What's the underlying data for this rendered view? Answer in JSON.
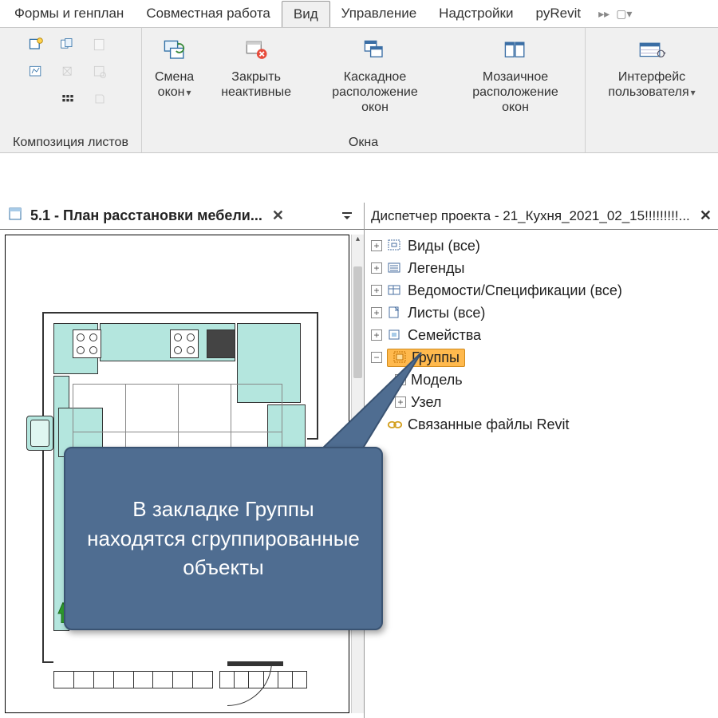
{
  "tabs": {
    "t0": "Формы и генплан",
    "t1": "Совместная работа",
    "t2": "Вид",
    "t3": "Управление",
    "t4": "Надстройки",
    "t5": "pyRevit"
  },
  "ribbon": {
    "panel1_title": "Композиция листов",
    "panel2_title": "Окна",
    "switch_windows": "Смена\nокон",
    "close_inactive": "Закрыть\nнеактивные",
    "cascade": "Каскадное\nрасположение окон",
    "tile": "Мозаичное\nрасположение окон",
    "ui": "Интерфейс\nпользователя"
  },
  "view_tab": {
    "title": "5.1 - План расстановки мебели..."
  },
  "browser": {
    "title": "Диспетчер проекта - 21_Кухня_2021_02_15!!!!!!!!!...",
    "items": {
      "views": "Виды (все)",
      "legends": "Легенды",
      "schedules": "Ведомости/Спецификации (все)",
      "sheets": "Листы (все)",
      "families": "Семейства",
      "groups": "Группы",
      "model": "Модель",
      "detail": "Узел",
      "links": "Связанные файлы Revit"
    }
  },
  "callout": {
    "text": "В закладке Группы находятся сгруппированные объекты"
  }
}
